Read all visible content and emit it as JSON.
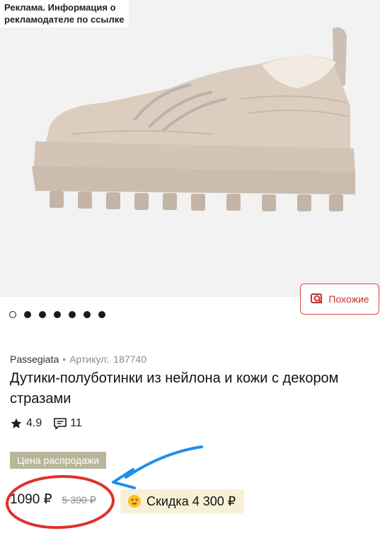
{
  "ad": {
    "line1": "Реклама. Информация о",
    "line2": "рекламодателе по ссылке"
  },
  "similar": {
    "label": "Похожие"
  },
  "gallery": {
    "total": 7,
    "active_index": 0
  },
  "product": {
    "brand": "Passegiata",
    "article_label": "Артикул:",
    "article_value": "187740",
    "title": "Дутики-полуботинки из нейлона и кожи с декором стразами",
    "rating": "4.9",
    "reviews": "11"
  },
  "sale": {
    "label": "Цена распродажи"
  },
  "price": {
    "current": "1090 ₽",
    "old": "5 390 ₽"
  },
  "discount": {
    "label": "Скидка 4 300 ₽"
  },
  "colors": {
    "accent_red": "#d64a43",
    "annotation_red": "#e0312b",
    "annotation_blue": "#1f8ee8",
    "sale_badge": "#b8b69a",
    "discount_bg": "#f6f1d6"
  }
}
